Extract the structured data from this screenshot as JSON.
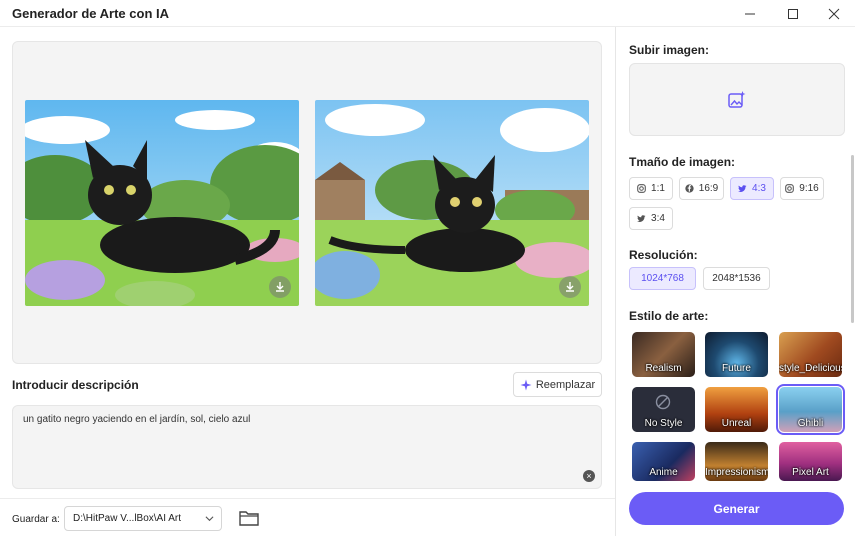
{
  "window": {
    "title": "Generador de Arte con IA"
  },
  "preview": {
    "image_count": 2
  },
  "description": {
    "label": "Introducir descripción",
    "replace_label": "Reemplazar",
    "text": "un gatito negro yaciendo en el jardín, sol, cielo azul"
  },
  "save": {
    "label": "Guardar a:",
    "path": "D:\\HitPaw V...lBox\\AI Art"
  },
  "upload": {
    "label": "Subir imagen:",
    "icon": "add-image-icon"
  },
  "size": {
    "label": "Tmaño de imagen:",
    "options": [
      {
        "label": "1:1",
        "icon": "instagram-icon",
        "active": false
      },
      {
        "label": "16:9",
        "icon": "facebook-icon",
        "active": false
      },
      {
        "label": "4:3",
        "icon": "twitter-icon",
        "active": true
      },
      {
        "label": "9:16",
        "icon": "instagram-icon",
        "active": false
      },
      {
        "label": "3:4",
        "icon": "twitter-icon",
        "active": false
      }
    ]
  },
  "resolution": {
    "label": "Resolución:",
    "options": [
      {
        "label": "1024*768",
        "active": true
      },
      {
        "label": "2048*1536",
        "active": false
      }
    ]
  },
  "style": {
    "label": "Estilo de arte:",
    "items": [
      {
        "label": "Realism",
        "selected": false
      },
      {
        "label": "Future",
        "selected": false
      },
      {
        "label": "style_Delicious",
        "selected": false
      },
      {
        "label": "No Style",
        "selected": false
      },
      {
        "label": "Unreal",
        "selected": false
      },
      {
        "label": "Ghibli",
        "selected": true
      },
      {
        "label": "Anime",
        "selected": false
      },
      {
        "label": "Impressionism",
        "selected": false
      },
      {
        "label": "Pixel Art",
        "selected": false
      }
    ]
  },
  "generate": {
    "label": "Generar"
  },
  "colors": {
    "accent": "#6b5cf6",
    "accent_light": "#eceaff"
  }
}
